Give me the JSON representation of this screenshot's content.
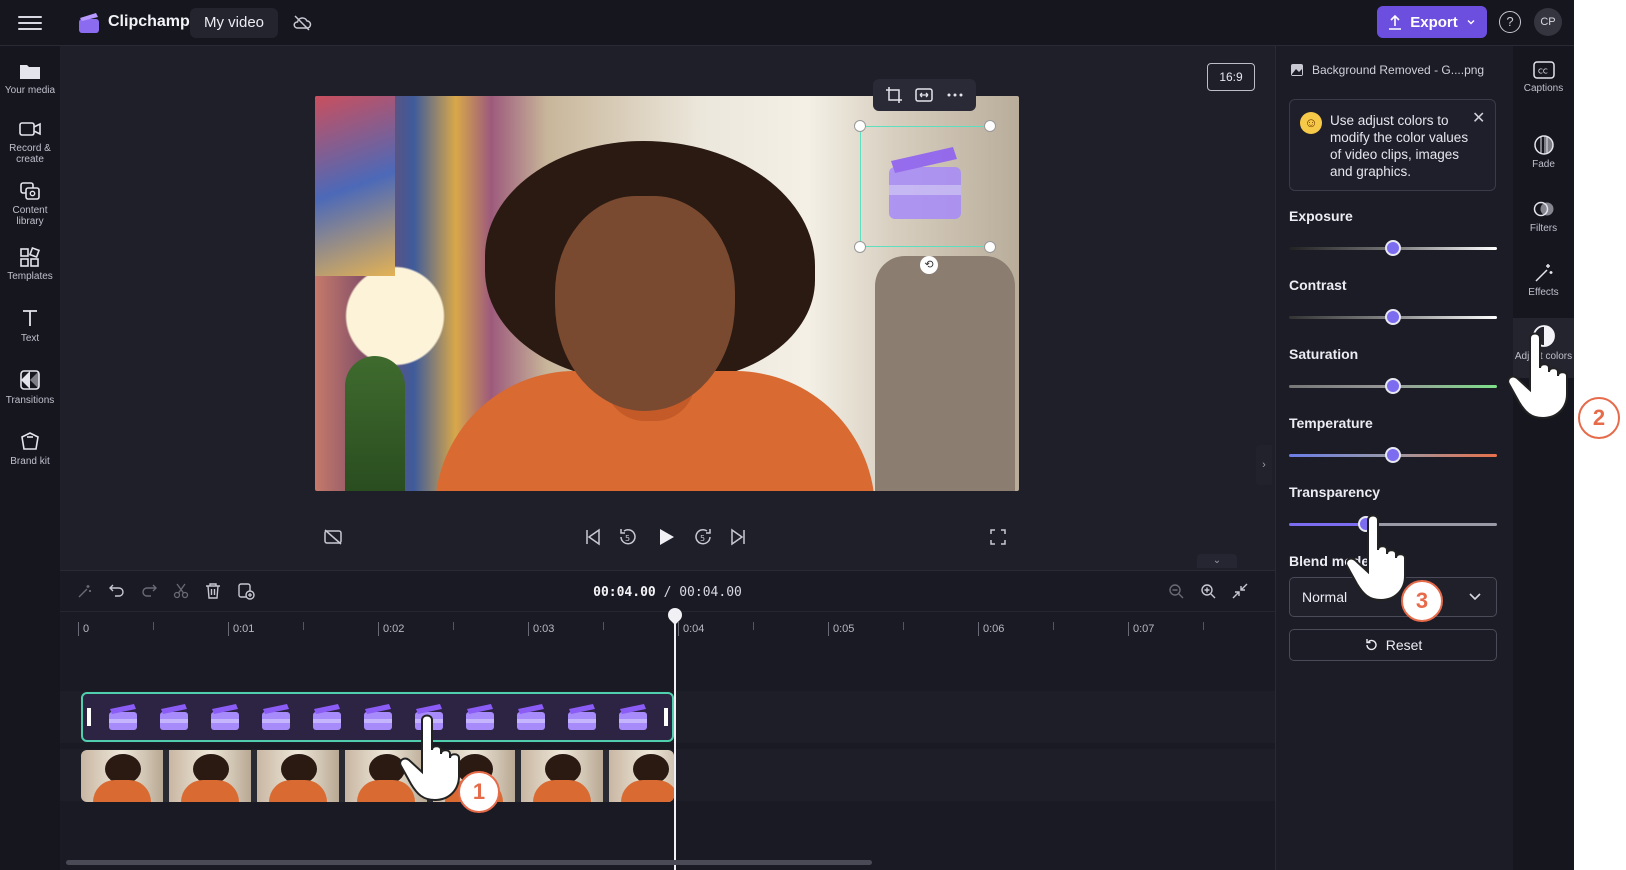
{
  "header": {
    "brand": "Clipchamp",
    "video_name": "My video",
    "export_label": "Export",
    "help": "?",
    "avatar_initials": "CP"
  },
  "left_sidebar": {
    "items": [
      {
        "label": "Your media",
        "icon": "folder-icon"
      },
      {
        "label": "Record &",
        "label2": "create",
        "icon": "camera-icon"
      },
      {
        "label": "Content",
        "label2": "library",
        "icon": "library-icon"
      },
      {
        "label": "Templates",
        "icon": "templates-icon"
      },
      {
        "label": "Text",
        "icon": "text-icon"
      },
      {
        "label": "Transitions",
        "icon": "transitions-icon"
      },
      {
        "label": "Brand kit",
        "icon": "brand-kit-icon"
      }
    ]
  },
  "preview": {
    "aspect_ratio": "16:9"
  },
  "timeline": {
    "current_time": "00:04.00",
    "separator": " / ",
    "total_time": "00:04.00",
    "ruler": [
      "0",
      "0:01",
      "0:02",
      "0:03",
      "0:04",
      "0:05",
      "0:06",
      "0:07"
    ]
  },
  "properties": {
    "file_name": "Background Removed - G....png",
    "tip": "Use adjust colors to modify the color values of video clips, images and graphics.",
    "sliders": [
      {
        "label": "Exposure",
        "value": 0.5
      },
      {
        "label": "Contrast",
        "value": 0.5
      },
      {
        "label": "Saturation",
        "value": 0.5
      },
      {
        "label": "Temperature",
        "value": 0.5
      },
      {
        "label": "Transparency",
        "value": 0.37
      }
    ],
    "blend_mode_label": "Blend mode",
    "blend_mode_value": "Normal",
    "reset_label": "Reset"
  },
  "right_tools": {
    "items": [
      {
        "label": "Captions",
        "icon": "captions-icon"
      },
      {
        "label": "Fade",
        "icon": "fade-icon"
      },
      {
        "label": "Filters",
        "icon": "filters-icon"
      },
      {
        "label": "Effects",
        "icon": "effects-icon"
      },
      {
        "label": "Adjust colors",
        "icon": "adjust-colors-icon"
      }
    ]
  },
  "steps": [
    "1",
    "2",
    "3"
  ],
  "colors": {
    "accent": "#6d4fe0",
    "selection": "#4fcfae",
    "step_ring": "#e66b4b"
  }
}
